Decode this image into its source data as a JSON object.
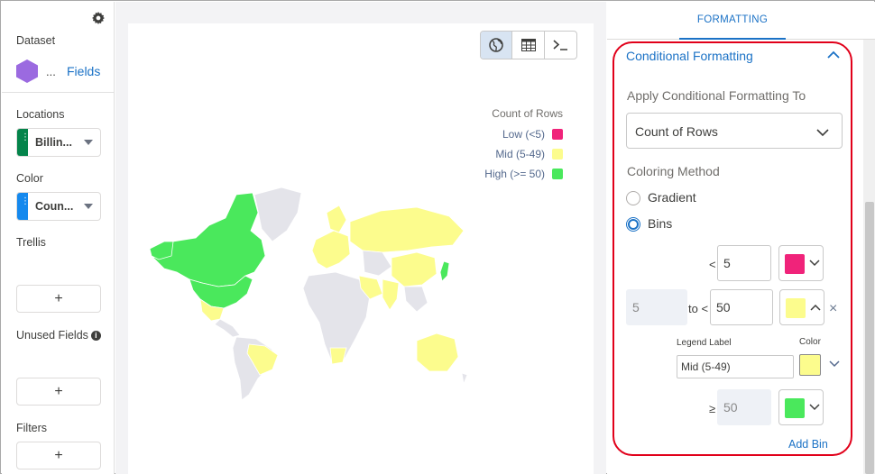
{
  "sidebar": {
    "dataset_label": "Dataset",
    "dataset_name": "...",
    "fields_link": "Fields",
    "locations_label": "Locations",
    "locations_field": "Billin...",
    "color_label": "Color",
    "color_field": "Coun...",
    "trellis_label": "Trellis",
    "unused_label": "Unused Fields",
    "filters_label": "Filters",
    "add_label": "+",
    "accent_green": "#04844b",
    "accent_blue": "#1589ee",
    "dataset_icon_color": "#9b6ae0"
  },
  "chart": {
    "viz_buttons": [
      "globe-icon",
      "table-icon",
      "console-icon"
    ],
    "legend_title": "Count of Rows",
    "legend": [
      {
        "label": "Low (<5)",
        "color": "#f0237a"
      },
      {
        "label": "Mid (5-49)",
        "color": "#fcfc8d"
      },
      {
        "label": "High (>= 50)",
        "color": "#4ae85c"
      }
    ]
  },
  "chart_data": {
    "type": "choropleth-map",
    "legend_title": "Count of Rows",
    "bins": [
      {
        "label": "Low (<5)",
        "max": 5,
        "color": "#f0237a"
      },
      {
        "label": "Mid (5-49)",
        "min": 5,
        "max": 50,
        "color": "#fcfc8d"
      },
      {
        "label": "High (>= 50)",
        "min": 50,
        "color": "#4ae85c"
      }
    ],
    "regions": [
      {
        "region": "North America",
        "bin": "High (>= 50)"
      },
      {
        "region": "Mexico",
        "bin": "Mid (5-49)"
      },
      {
        "region": "Brazil",
        "bin": "Mid (5-49)"
      },
      {
        "region": "Russia",
        "bin": "Mid (5-49)"
      },
      {
        "region": "China",
        "bin": "Mid (5-49)"
      },
      {
        "region": "Japan",
        "bin": "High (>= 50)"
      },
      {
        "region": "India",
        "bin": "Mid (5-49)"
      },
      {
        "region": "Australia",
        "bin": "Mid (5-49)"
      },
      {
        "region": "Europe",
        "bin": "Mid (5-49)"
      },
      {
        "region": "Saudi Arabia",
        "bin": "Mid (5-49)"
      },
      {
        "region": "South Africa",
        "bin": "Mid (5-49)"
      }
    ]
  },
  "panel": {
    "tab": "FORMATTING",
    "section_title": "Conditional Formatting",
    "apply_label": "Apply Conditional Formatting To",
    "apply_value": "Count of Rows",
    "method_label": "Coloring Method",
    "method_options": [
      "Gradient",
      "Bins"
    ],
    "method_selected": "Bins",
    "bins": [
      {
        "op": "<",
        "value": "5",
        "color": "#f0237a"
      },
      {
        "from": "5",
        "op": "to <",
        "value": "50",
        "color": "#fcfc8d"
      },
      {
        "op": "≥",
        "value": "50",
        "color": "#4ae85c"
      }
    ],
    "legend_label_caption": "Legend Label",
    "color_caption": "Color",
    "legend_label_value": "Mid (5-49)",
    "remove_symbol": "×",
    "add_bin": "Add Bin",
    "highlight_color": "#e1001a"
  }
}
